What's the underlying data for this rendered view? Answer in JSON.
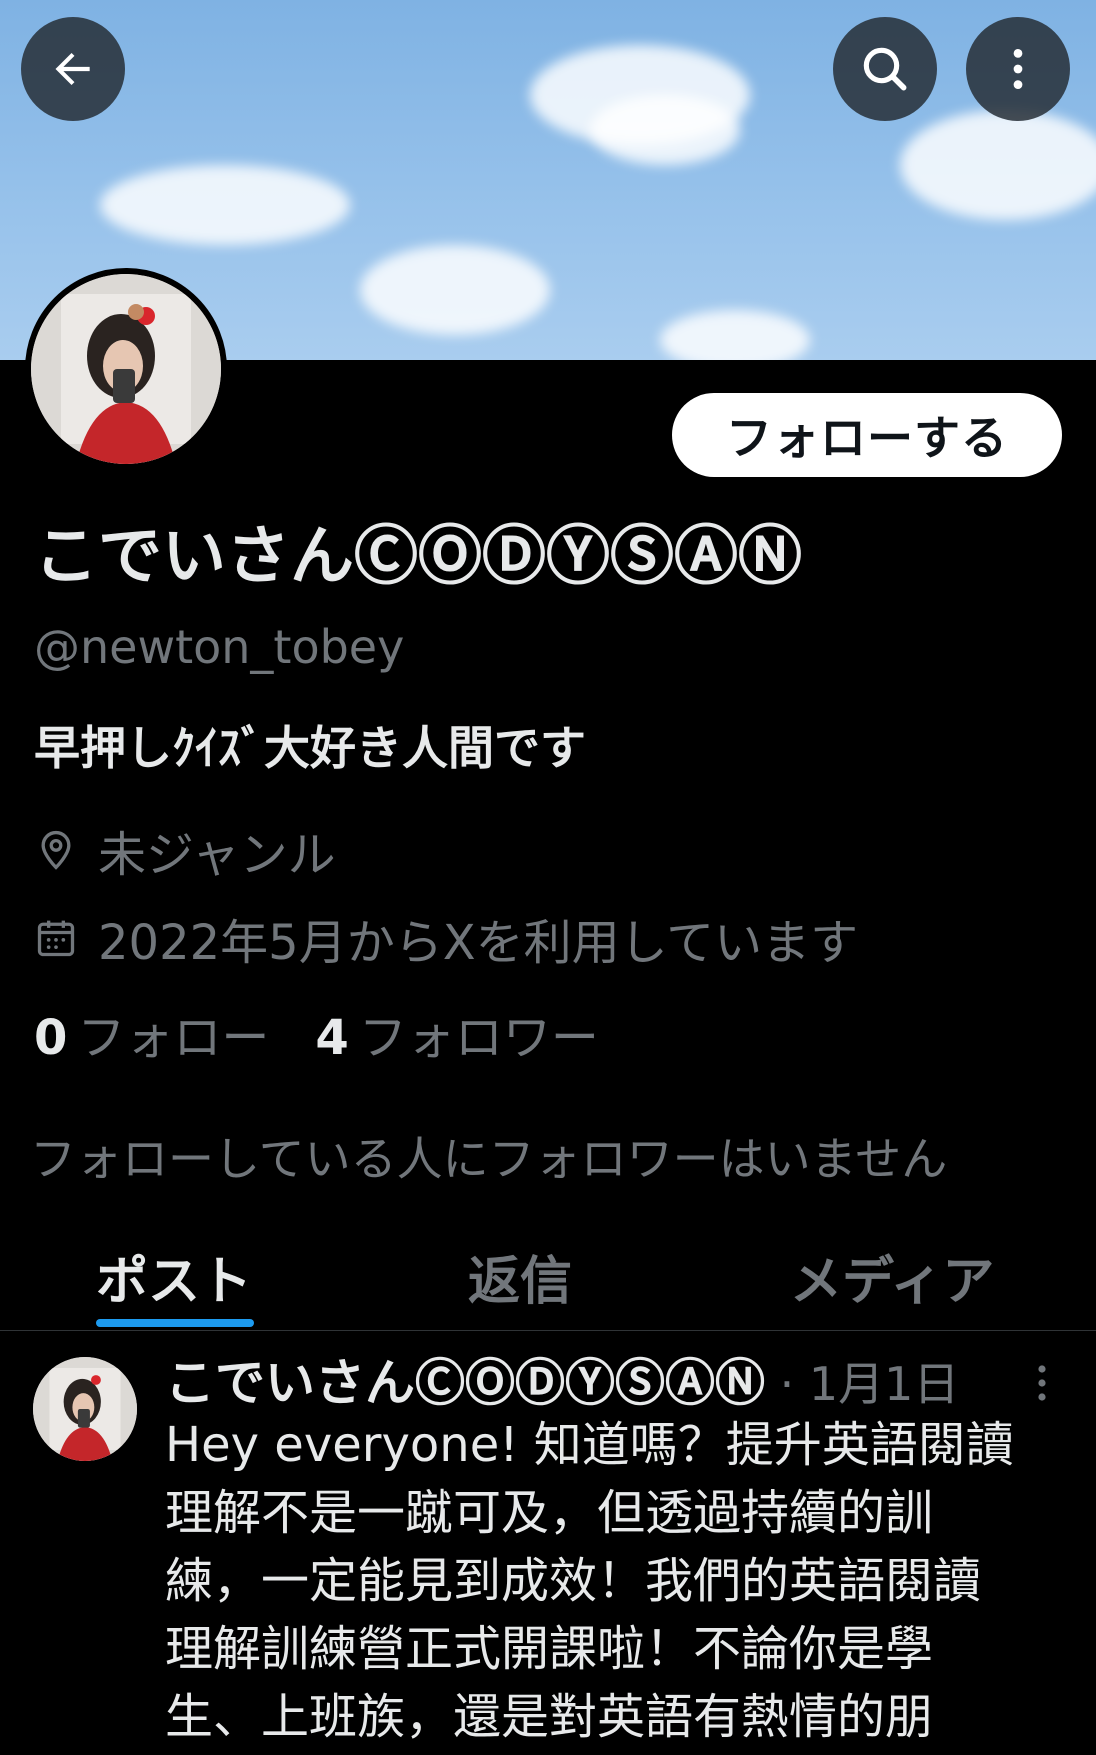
{
  "header": {
    "back_icon": "arrow-left-icon",
    "search_icon": "search-icon",
    "more_icon": "more-vertical-icon"
  },
  "profile": {
    "display_name": "こでいさんⒸⓄⒹⓎⓈⒶⓃ",
    "handle": "@newton_tobey",
    "bio": "早押しｸｲｽﾞ大好き人間です",
    "location": "未ジャンル",
    "joined": "2022年5月からXを利用しています",
    "following_count": "0",
    "following_label": "フォロー",
    "followers_count": "4",
    "followers_label": "フォロワー",
    "followed_by_note": "フォローしている人にフォロワーはいません",
    "follow_button": "フォローする"
  },
  "tabs": [
    {
      "label": "ポスト",
      "active": true
    },
    {
      "label": "返信",
      "active": false
    },
    {
      "label": "メディア",
      "active": false
    }
  ],
  "post": {
    "author": "こでいさんⒸⓄⒹⓎⓈⒶⓃ",
    "separator": " · ",
    "date": "1月1日",
    "text": "Hey everyone! 知道嗎？提升英語閱讀\n理解不是一蹴可及，但透過持續的訓\n練，一定能見到成效！我們的英語閱讀\n理解訓練營正式開課啦！不論你是學\n生、上班族，還是對英語有熱情的朋"
  },
  "colors": {
    "background": "#000000",
    "accent": "#1d9bf0",
    "secondary_text": "#71767b"
  }
}
